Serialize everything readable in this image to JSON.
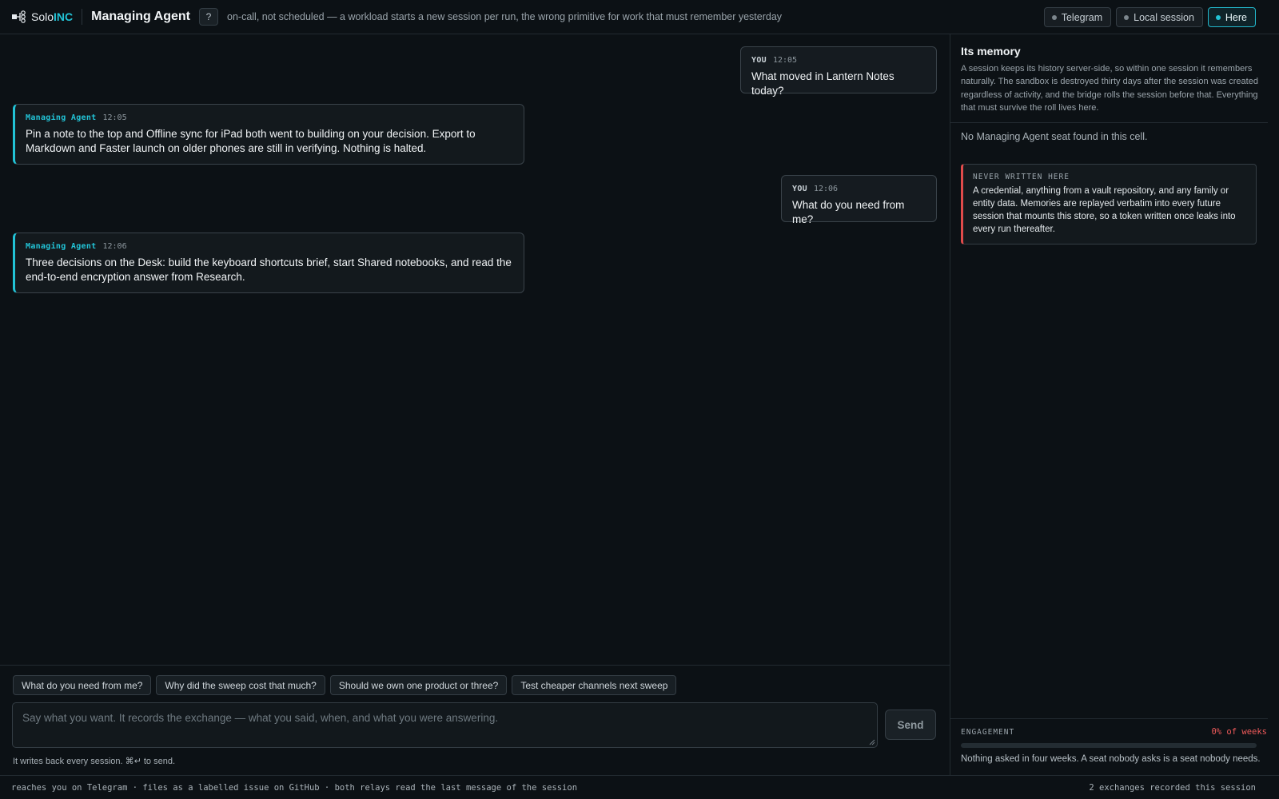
{
  "header": {
    "logo_prefix": "Solo",
    "logo_accent": "INC",
    "title": "Managing Agent",
    "help_label": "?",
    "tagline": "on-call, not scheduled — a workload starts a new session per run, the wrong primitive for work that must remember yesterday",
    "channels": [
      {
        "label": "Telegram",
        "active": false
      },
      {
        "label": "Local session",
        "active": false
      },
      {
        "label": "Here",
        "active": true
      }
    ]
  },
  "messages": [
    {
      "role": "user",
      "who": "YOU",
      "time": "12:05",
      "text": "What moved in Lantern Notes today?"
    },
    {
      "role": "agent",
      "who": "Managing Agent",
      "time": "12:05",
      "text": "Pin a note to the top and Offline sync for iPad both went to building on your decision. Export to Markdown and Faster launch on older phones are still in verifying. Nothing is halted."
    },
    {
      "role": "user",
      "who": "YOU",
      "time": "12:06",
      "text": "What do you need from me?"
    },
    {
      "role": "agent",
      "who": "Managing Agent",
      "time": "12:06",
      "text": "Three decisions on the Desk: build the keyboard shortcuts brief, start Shared notebooks, and read the end-to-end encryption answer from Research."
    }
  ],
  "composer": {
    "suggestions": [
      "What do you need from me?",
      "Why did the sweep cost that much?",
      "Should we own one product or three?",
      "Test cheaper channels next sweep"
    ],
    "placeholder": "Say what you want. It records the exchange — what you said, when, and what you were answering.",
    "send_label": "Send",
    "hint": "It writes back every session. ⌘↵ to send."
  },
  "memory": {
    "title": "Its memory",
    "description": "A session keeps its history server-side, so within one session it remembers naturally. The sandbox is destroyed thirty days after the session was created regardless of activity, and the bridge rolls the session before that. Everything that must survive the roll lives here.",
    "no_seat": "No Managing Agent seat found in this cell.",
    "never_label": "NEVER WRITTEN HERE",
    "never_text": "A credential, anything from a vault repository, and any family or entity data. Memories are replayed verbatim into every future session that mounts this store, so a token written once leaks into every run thereafter."
  },
  "engagement": {
    "label": "ENGAGEMENT",
    "value_text": "0% of weeks",
    "percent": 0,
    "note": "Nothing asked in four weeks. A seat nobody asks is a seat nobody needs."
  },
  "footer": {
    "left": "reaches you on Telegram · files as a labelled issue on GitHub · both relays read the last message of the session",
    "right": "2 exchanges recorded this session"
  },
  "colors": {
    "accent": "#22c3d6",
    "danger": "#ef5a5a",
    "background": "#0c1115"
  }
}
